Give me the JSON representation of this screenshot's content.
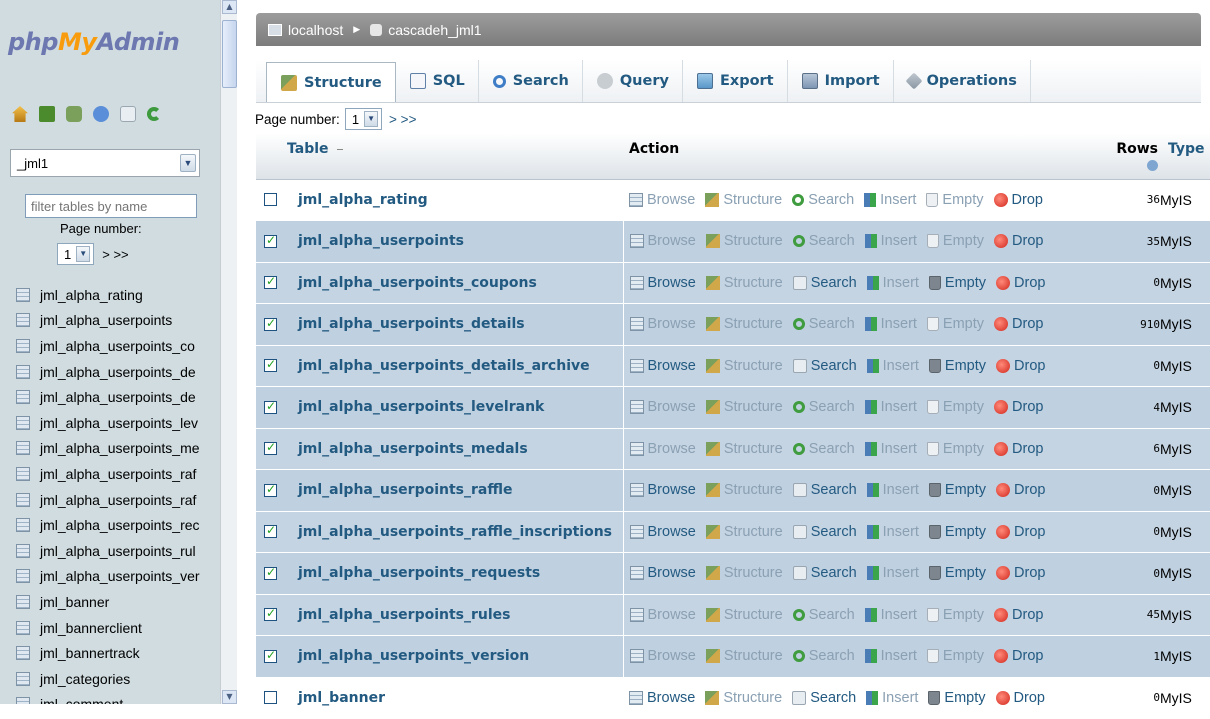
{
  "app": {
    "logo_php": "php",
    "logo_my": "My",
    "logo_admin": "Admin"
  },
  "sidebar": {
    "db_selected": "_jml1",
    "filter_placeholder": "filter tables by name",
    "page_label": "Page number:",
    "page_value": "1",
    "page_next": "> >>",
    "icons": [
      "home-icon",
      "exit-icon",
      "query-window-icon",
      "docs-icon",
      "sql-docs-icon",
      "reload-icon"
    ],
    "tables": [
      "jml_alpha_rating",
      "jml_alpha_userpoints",
      "jml_alpha_userpoints_co",
      "jml_alpha_userpoints_de",
      "jml_alpha_userpoints_de",
      "jml_alpha_userpoints_lev",
      "jml_alpha_userpoints_me",
      "jml_alpha_userpoints_raf",
      "jml_alpha_userpoints_raf",
      "jml_alpha_userpoints_rec",
      "jml_alpha_userpoints_rul",
      "jml_alpha_userpoints_ver",
      "jml_banner",
      "jml_bannerclient",
      "jml_bannertrack",
      "jml_categories",
      "jml_comment"
    ]
  },
  "breadcrumb": {
    "server": "localhost",
    "database": "cascadeh_jml1"
  },
  "tabs": [
    {
      "label": "Structure",
      "icon": "structure-icon",
      "active": true
    },
    {
      "label": "SQL",
      "icon": "sql-icon"
    },
    {
      "label": "Search",
      "icon": "search-icon"
    },
    {
      "label": "Query",
      "icon": "query-icon"
    },
    {
      "label": "Export",
      "icon": "export-icon"
    },
    {
      "label": "Import",
      "icon": "import-icon"
    },
    {
      "label": "Operations",
      "icon": "operations-icon"
    }
  ],
  "pager": {
    "label": "Page number:",
    "value": "1",
    "next": "> >>"
  },
  "table": {
    "headers": {
      "table": "Table",
      "action": "Action",
      "rows": "Rows",
      "type": "Type"
    },
    "action_labels": {
      "browse": "Browse",
      "structure": "Structure",
      "search": "Search",
      "insert": "Insert",
      "empty": "Empty",
      "drop": "Drop"
    },
    "rows": [
      {
        "name": "jml_alpha_rating",
        "checked": false,
        "has_data": true,
        "rows": "36",
        "type": "MyIS"
      },
      {
        "name": "jml_alpha_userpoints",
        "checked": true,
        "has_data": true,
        "rows": "35",
        "type": "MyIS"
      },
      {
        "name": "jml_alpha_userpoints_coupons",
        "checked": true,
        "has_data": false,
        "rows": "0",
        "type": "MyIS"
      },
      {
        "name": "jml_alpha_userpoints_details",
        "checked": true,
        "has_data": true,
        "rows": "910",
        "type": "MyIS"
      },
      {
        "name": "jml_alpha_userpoints_details_archive",
        "checked": true,
        "has_data": false,
        "rows": "0",
        "type": "MyIS"
      },
      {
        "name": "jml_alpha_userpoints_levelrank",
        "checked": true,
        "has_data": true,
        "rows": "4",
        "type": "MyIS"
      },
      {
        "name": "jml_alpha_userpoints_medals",
        "checked": true,
        "has_data": true,
        "rows": "6",
        "type": "MyIS"
      },
      {
        "name": "jml_alpha_userpoints_raffle",
        "checked": true,
        "has_data": false,
        "rows": "0",
        "type": "MyIS"
      },
      {
        "name": "jml_alpha_userpoints_raffle_inscriptions",
        "checked": true,
        "has_data": false,
        "rows": "0",
        "type": "MyIS"
      },
      {
        "name": "jml_alpha_userpoints_requests",
        "checked": true,
        "has_data": false,
        "rows": "0",
        "type": "MyIS"
      },
      {
        "name": "jml_alpha_userpoints_rules",
        "checked": true,
        "has_data": true,
        "rows": "45",
        "type": "MyIS"
      },
      {
        "name": "jml_alpha_userpoints_version",
        "checked": true,
        "has_data": true,
        "rows": "1",
        "type": "MyIS"
      },
      {
        "name": "jml_banner",
        "checked": false,
        "has_data": false,
        "rows": "0",
        "type": "MyIS"
      }
    ]
  },
  "colors": {
    "link": "#235a81",
    "marked_row": "#c5d4e3",
    "sidebar_bg": "#d0dce0",
    "breadcrumb_bg": "#8a8a8a"
  }
}
